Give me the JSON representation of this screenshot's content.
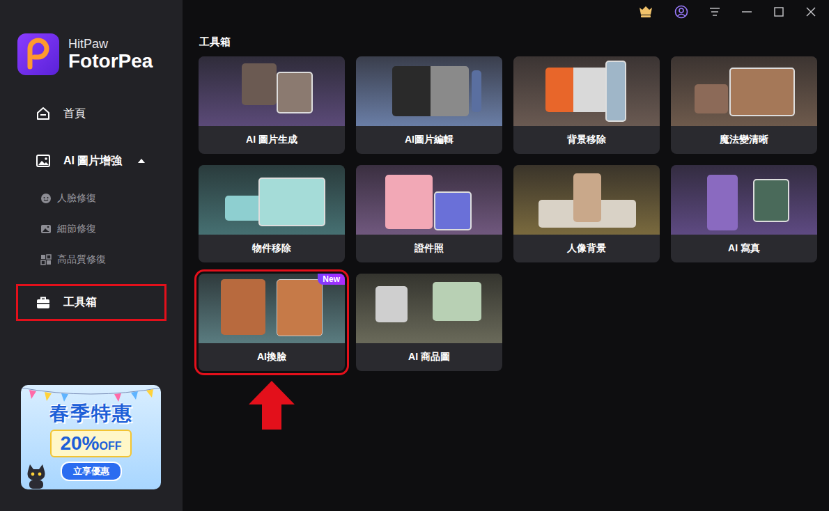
{
  "app": {
    "brand": "HitPaw",
    "product": "FotorPea"
  },
  "sidebar": {
    "items": [
      {
        "label": "首頁",
        "kind": "main",
        "highlighted": false
      },
      {
        "label": "AI 圖片增強",
        "kind": "group",
        "expanded": true,
        "highlighted": false
      },
      {
        "label": "人臉修復",
        "kind": "sub",
        "highlighted": false
      },
      {
        "label": "細節修復",
        "kind": "sub",
        "highlighted": false
      },
      {
        "label": "高品質修復",
        "kind": "sub",
        "highlighted": false
      },
      {
        "label": "工具箱",
        "kind": "main",
        "highlighted": true
      }
    ]
  },
  "promo": {
    "title": "春季特惠",
    "discount": "20%",
    "off": "OFF",
    "button": "立享優惠"
  },
  "main": {
    "title": "工具箱",
    "cards": [
      {
        "label": "AI 圖片生成",
        "highlighted": false,
        "pointer_arrow": false
      },
      {
        "label": "AI圖片編輯",
        "highlighted": false,
        "pointer_arrow": false
      },
      {
        "label": "背景移除",
        "highlighted": false,
        "pointer_arrow": false
      },
      {
        "label": "魔法變清晰",
        "highlighted": false,
        "pointer_arrow": false
      },
      {
        "label": "物件移除",
        "highlighted": false,
        "pointer_arrow": false
      },
      {
        "label": "證件照",
        "highlighted": false,
        "pointer_arrow": false
      },
      {
        "label": "人像背景",
        "highlighted": false,
        "pointer_arrow": false
      },
      {
        "label": "AI 寫真",
        "highlighted": false,
        "pointer_arrow": false
      },
      {
        "label": "AI換臉",
        "badge": "New",
        "highlighted": true,
        "pointer_arrow": true
      },
      {
        "label": "AI 商品圖",
        "highlighted": false,
        "pointer_arrow": false
      }
    ]
  }
}
